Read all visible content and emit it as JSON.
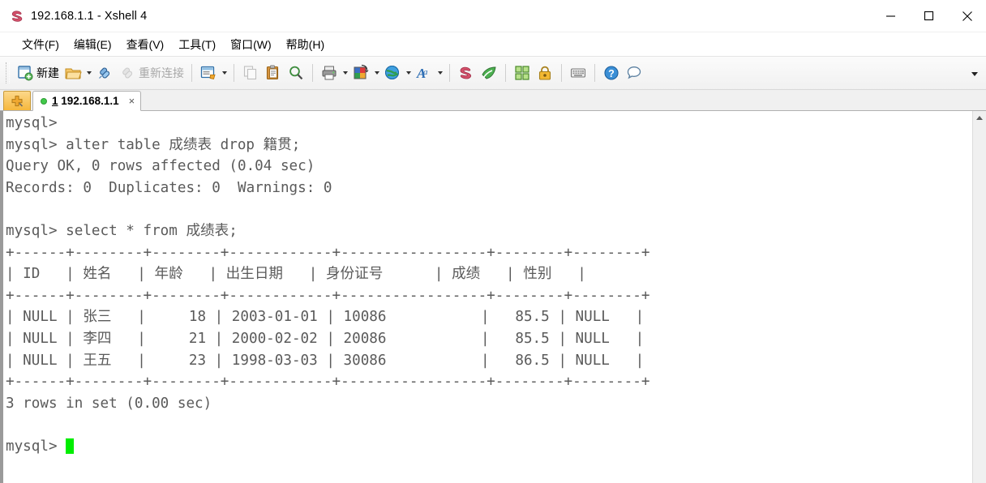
{
  "window": {
    "title": "192.168.1.1 - Xshell 4",
    "app_icon": "xshell-icon",
    "minimize_label": "Minimize",
    "maximize_label": "Maximize",
    "close_label": "Close"
  },
  "menubar": {
    "items": [
      {
        "label": "文件(F)",
        "name": "menu-file"
      },
      {
        "label": "编辑(E)",
        "name": "menu-edit"
      },
      {
        "label": "查看(V)",
        "name": "menu-view"
      },
      {
        "label": "工具(T)",
        "name": "menu-tools"
      },
      {
        "label": "窗口(W)",
        "name": "menu-window"
      },
      {
        "label": "帮助(H)",
        "name": "menu-help"
      }
    ]
  },
  "toolbar": {
    "new_label": "新建",
    "reconnect_label": "重新连接",
    "overflow_label": "More toolbar buttons",
    "icons": {
      "new": "new-session-icon",
      "open": "open-folder-icon",
      "connect": "connect-icon",
      "disconnect": "disconnect-icon",
      "properties": "session-properties-icon",
      "copy": "copy-icon",
      "paste": "paste-icon",
      "find": "find-icon",
      "print": "print-icon",
      "color": "color-scheme-icon",
      "globe": "globe-icon",
      "font": "font-icon",
      "xshell": "xshell-icon",
      "xftp": "xftp-icon",
      "arrange": "arrange-windows-icon",
      "lock": "lock-icon",
      "keyboard": "keyboard-icon",
      "help": "help-icon",
      "chat": "chat-icon"
    }
  },
  "tabbar": {
    "new_tab_label": "New Tab",
    "tabs": [
      {
        "index": "1",
        "title": "192.168.1.1",
        "close": "×",
        "status": "connected"
      }
    ]
  },
  "terminal": {
    "prompt": "mysql>",
    "cursor_color": "#00ee00",
    "lines": [
      "mysql>",
      "mysql> alter table 成绩表 drop 籍贯;",
      "Query OK, 0 rows affected (0.04 sec)",
      "Records: 0  Duplicates: 0  Warnings: 0",
      "",
      "mysql> select * from 成绩表;",
      "+------+--------+--------+------------+-----------------+--------+--------+",
      "| ID   | 姓名   | 年龄   | 出生日期   | 身份证号      | 成绩   | 性别   |",
      "+------+--------+--------+------------+-----------------+--------+--------+",
      "| NULL | 张三   |     18 | 2003-01-01 | 10086           |   85.5 | NULL   |",
      "| NULL | 李四   |     21 | 2000-02-02 | 20086           |   85.5 | NULL   |",
      "| NULL | 王五   |     23 | 1998-03-03 | 30086           |   86.5 | NULL   |",
      "+------+--------+--------+------------+-----------------+--------+--------+",
      "3 rows in set (0.00 sec)",
      "",
      "mysql> "
    ],
    "query_results": {
      "columns": [
        "ID",
        "姓名",
        "年龄",
        "出生日期",
        "身份证号",
        "成绩",
        "性别"
      ],
      "rows": [
        [
          "NULL",
          "张三",
          "18",
          "2003-01-01",
          "10086",
          "85.5",
          "NULL"
        ],
        [
          "NULL",
          "李四",
          "21",
          "2000-02-02",
          "20086",
          "85.5",
          "NULL"
        ],
        [
          "NULL",
          "王五",
          "23",
          "1998-03-03",
          "30086",
          "86.5",
          "NULL"
        ]
      ],
      "row_count_text": "3 rows in set (0.00 sec)"
    }
  },
  "scrollbar": {
    "up_arrow": "scroll-up-arrow"
  }
}
